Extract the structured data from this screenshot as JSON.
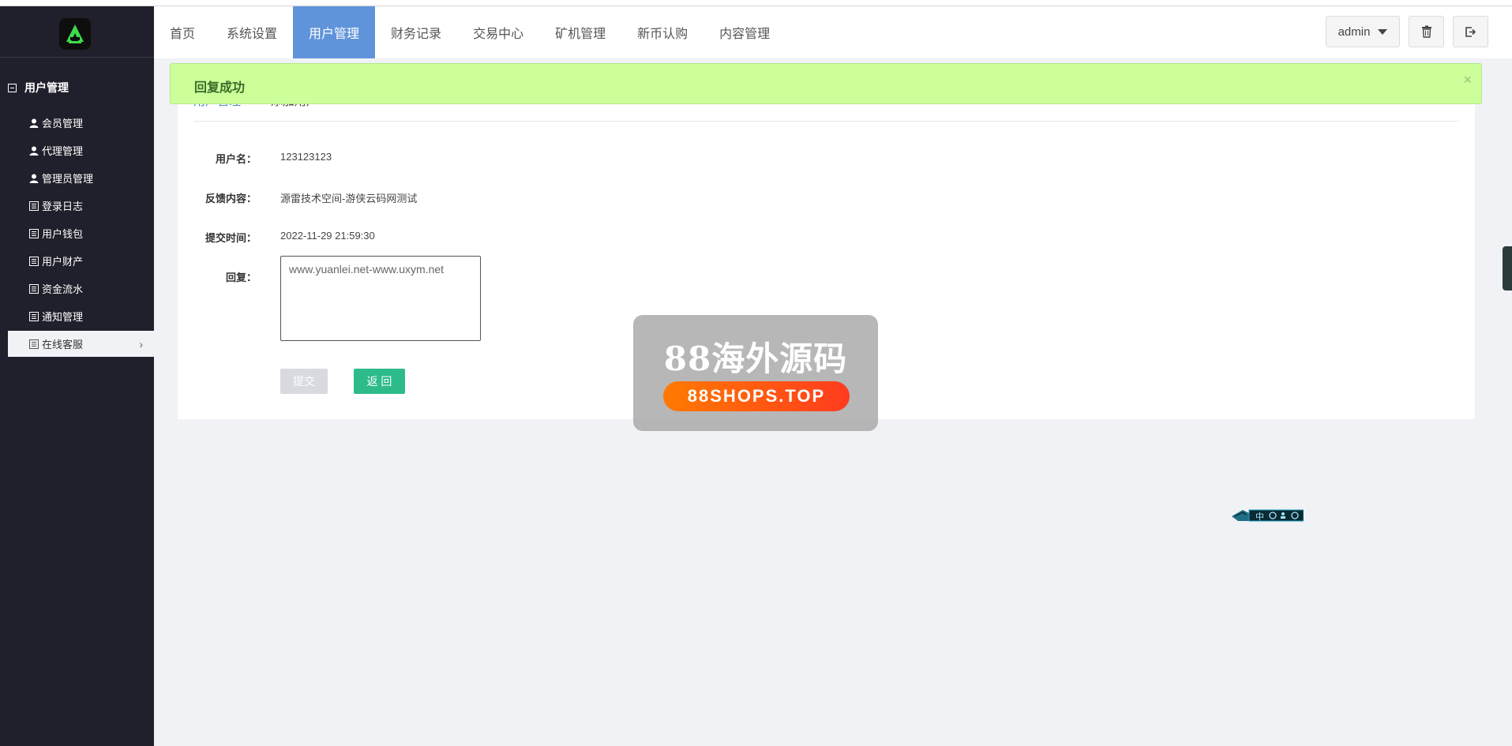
{
  "header": {
    "nav": [
      {
        "label": "首页",
        "active": false
      },
      {
        "label": "系统设置",
        "active": false
      },
      {
        "label": "用户管理",
        "active": true
      },
      {
        "label": "财务记录",
        "active": false
      },
      {
        "label": "交易中心",
        "active": false
      },
      {
        "label": "矿机管理",
        "active": false
      },
      {
        "label": "新币认购",
        "active": false
      },
      {
        "label": "内容管理",
        "active": false
      }
    ],
    "user": "admin"
  },
  "sidebar": {
    "heading": "用户管理",
    "items": [
      {
        "label": "会员管理",
        "icon": "user-icon"
      },
      {
        "label": "代理管理",
        "icon": "user-icon"
      },
      {
        "label": "管理员管理",
        "icon": "user-icon"
      },
      {
        "label": "登录日志",
        "icon": "list-icon"
      },
      {
        "label": "用户钱包",
        "icon": "list-icon"
      },
      {
        "label": "用户财产",
        "icon": "list-icon"
      },
      {
        "label": "资金流水",
        "icon": "list-icon"
      },
      {
        "label": "通知管理",
        "icon": "list-icon"
      },
      {
        "label": "在线客服",
        "icon": "list-icon",
        "active": true
      }
    ]
  },
  "alert": {
    "message": "回复成功",
    "close": "×"
  },
  "breadcrumb": {
    "parent": "用户管理",
    "separator": ">>",
    "current": "添加用户"
  },
  "form": {
    "username_label": "用户名：",
    "username_value": "123123123",
    "feedback_label": "反馈内容：",
    "feedback_value": "源雷技术空间-游侠云码网测试",
    "time_label": "提交时间：",
    "time_value": "2022-11-29 21:59:30",
    "reply_label": "回复：",
    "reply_placeholder": "www.yuanlei.net-www.uxym.net",
    "submit_label": "提交",
    "back_label": "返 回"
  },
  "watermark": {
    "title": "88海外源码",
    "url": "88SHOPS.TOP"
  },
  "widget": {
    "label": "中"
  },
  "colors": {
    "sidebar_bg": "#20202c",
    "nav_active": "#6094da",
    "alert_bg": "#ccff99",
    "back_button": "#2dbb8a",
    "submit_button": "#d8dadf"
  }
}
